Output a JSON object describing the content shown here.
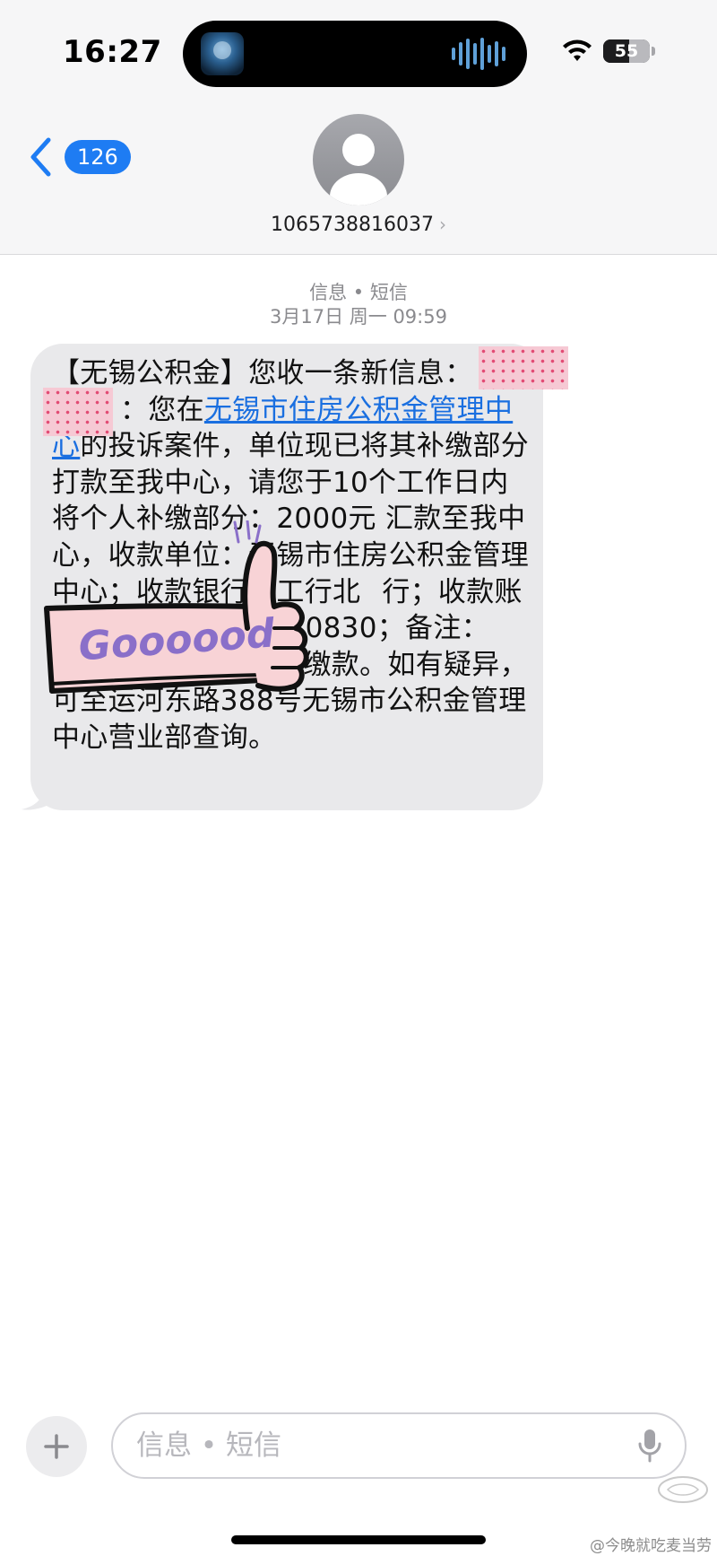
{
  "status_bar": {
    "time": "16:27",
    "battery_level": "55",
    "battery_fraction": 0.55,
    "icons": [
      "wifi-icon",
      "battery-icon"
    ]
  },
  "header": {
    "back_badge_count": "126",
    "contact_number": "1065738816037",
    "icons": [
      "back-chevron-icon",
      "contact-avatar-icon",
      "chevron-right-icon"
    ],
    "accent_color": "#1e7cf3"
  },
  "conversation": {
    "service_label": "信息 • 短信",
    "timestamp": "3月17日 周一 09:59",
    "message": {
      "seg1": "【无锡公积金】您收一条新信息：",
      "seg2": "：您在",
      "link_text": "无锡市住房公积金管理中心",
      "seg3": "的投诉案件，单位现已将其补缴部分打款至我中心，请您于10个工作日内将个人补缴部分：2000元 汇款至我中心，收款单位：无锡市住房公积金管理中心；收款银行：工行北",
      "seg4": "行；收款账号：",
      "seg5": "20830；备注：",
      "seg6": "缴",
      "seg7": "公积金补缴款。如有疑异，可至运河东路388号无锡市公积金管理中心营业部查询。"
    },
    "bubble_color": "#e9e9eb",
    "link_color": "#1a6fe0"
  },
  "sticker": {
    "text": "Goooood",
    "fill_color": "#f8d3d6",
    "text_color": "#8a6fc9"
  },
  "composer": {
    "placeholder": "信息 • 短信",
    "icons": [
      "plus-icon",
      "microphone-icon"
    ]
  },
  "watermark": {
    "text": "@今晚就吃麦当劳"
  }
}
